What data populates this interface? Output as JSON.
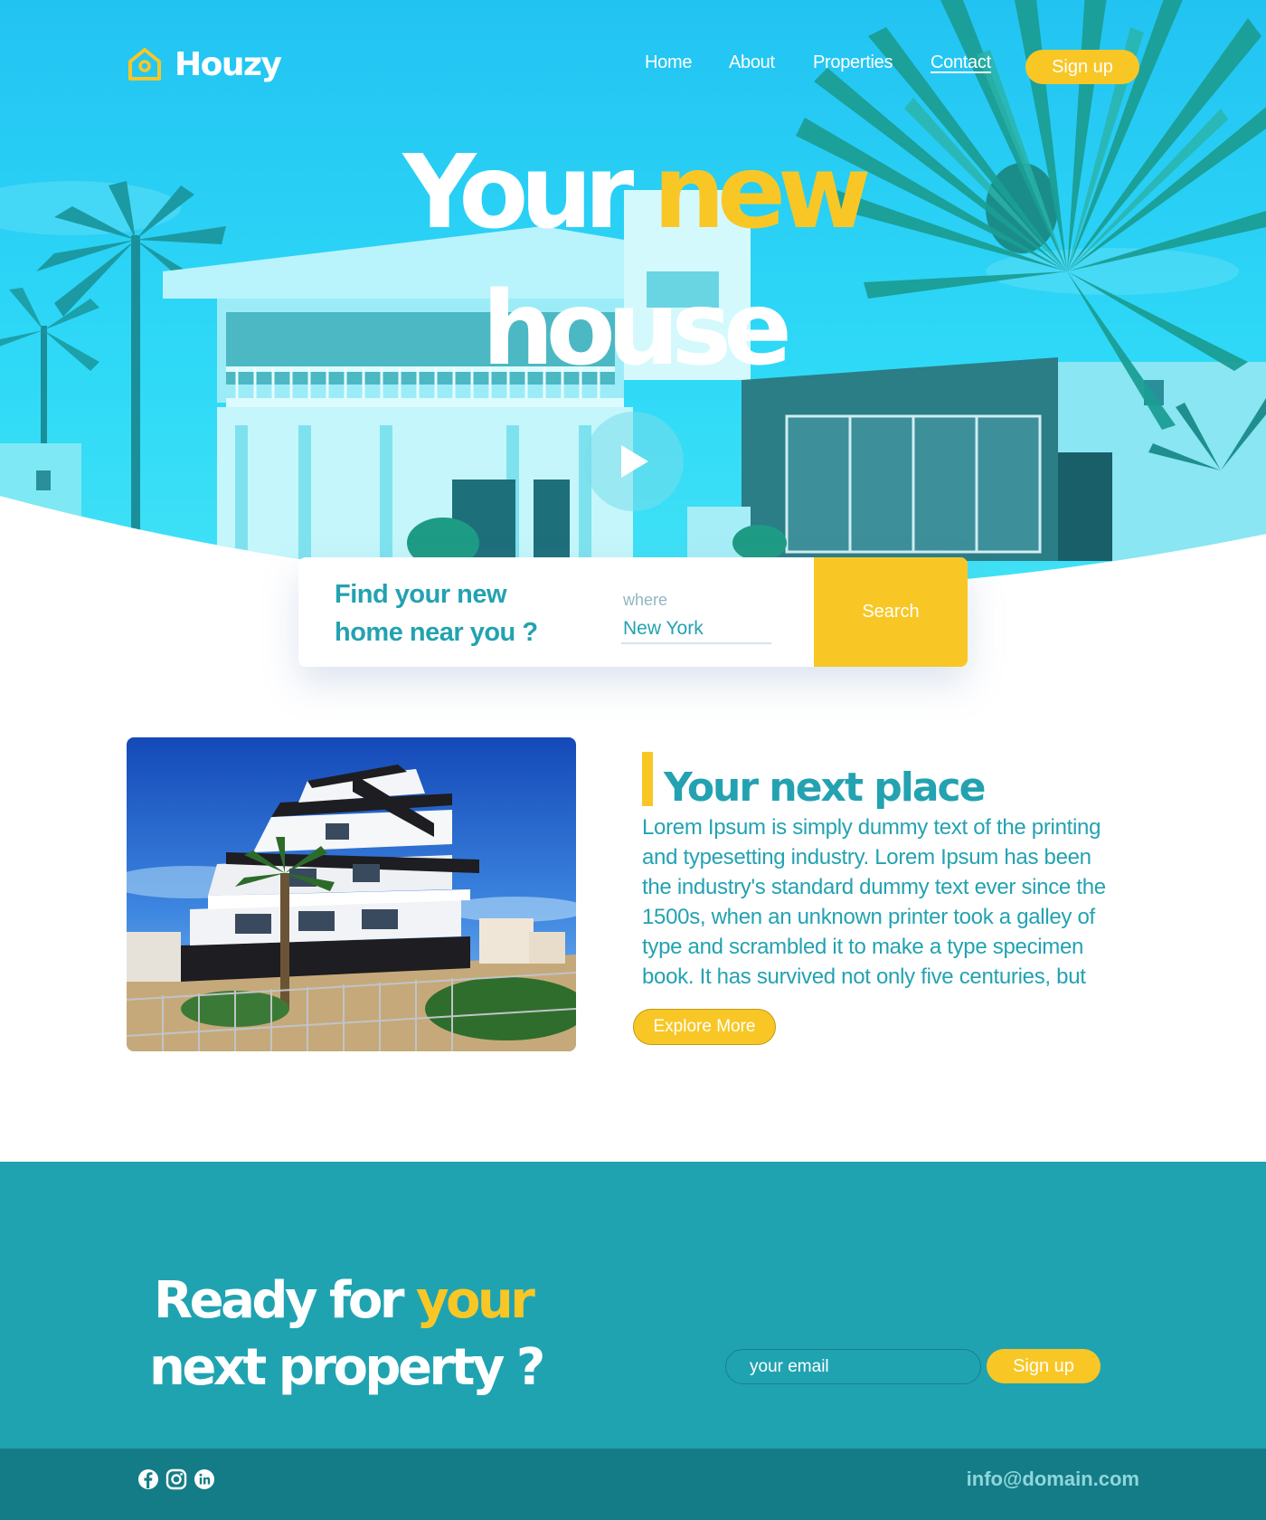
{
  "brand": {
    "name": "Houzy",
    "logo_icon": "house-icon"
  },
  "nav": {
    "links": [
      "Home",
      "About",
      "Properties",
      "Contact"
    ],
    "active": "Contact",
    "signup_label": "Sign up"
  },
  "hero": {
    "title_line1_white": "Your",
    "title_line1_accent": "new",
    "title_line2": "house",
    "play_icon": "play-icon"
  },
  "search": {
    "question": "Find your new home near you ?",
    "where_label": "where",
    "where_value": "New York",
    "button_label": "Search"
  },
  "feature": {
    "title": "Your next place",
    "body": "Lorem Ipsum is simply dummy text of the printing and typesetting industry. Lorem Ipsum has been the industry's standard dummy text ever since the 1500s, when an unknown printer took a galley of type and scrambled it to make a type specimen book. It has survived not only five centuries, but",
    "button_label": "Explore More"
  },
  "cta": {
    "line1_white": "Ready for",
    "line1_accent": "your",
    "line2": "next property ?",
    "email_placeholder": "your email",
    "signup_label": "Sign up"
  },
  "footer": {
    "social_icons": [
      "facebook-icon",
      "instagram-icon",
      "linkedin-icon"
    ],
    "email": "info@domain.com"
  },
  "colors": {
    "accent": "#f8c726",
    "teal": "#20a3b1",
    "teal_text": "#23a2b1",
    "footer": "#147c86",
    "hero_sky": "#2ad5f5"
  }
}
